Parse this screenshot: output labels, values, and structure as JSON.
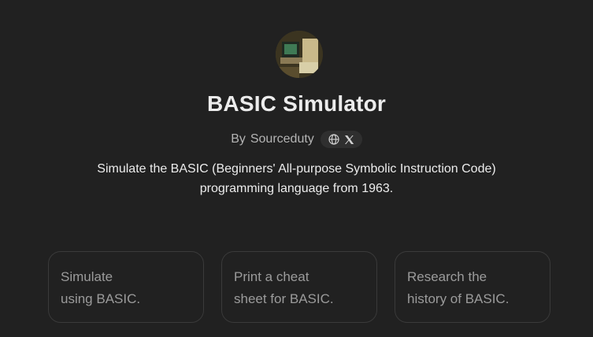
{
  "gpt": {
    "title": "BASIC Simulator",
    "author_prefix": "By",
    "author": "Sourceduty",
    "description_line1": "Simulate the BASIC (Beginners' All-purpose Symbolic Instruction Code)",
    "description_line2": "programming language from 1963."
  },
  "social_icons": [
    "globe-icon",
    "x-logo-icon"
  ],
  "suggestions": [
    {
      "line1": "Simulate",
      "line2": "using BASIC."
    },
    {
      "line1": "Print a cheat",
      "line2": "sheet for BASIC."
    },
    {
      "line1": "Research the",
      "line2": "history of BASIC."
    }
  ],
  "colors": {
    "background": "#212121",
    "text_primary": "#ececec",
    "text_secondary": "#b4b4b4",
    "card_text": "#9b9b9b",
    "card_border": "#3a3a3a"
  }
}
